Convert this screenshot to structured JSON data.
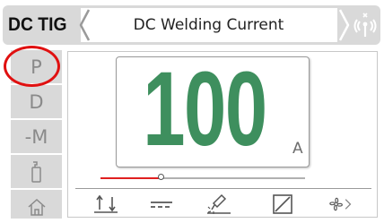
{
  "header": {
    "mode": "DC TIG",
    "title": "DC Welding Current",
    "icons": [
      "back-chevron-icon",
      "forward-chevron-icon",
      "wireless-remote-icon"
    ]
  },
  "sidebar": {
    "items": [
      {
        "label": "P",
        "icon": "p-text"
      },
      {
        "label": "D",
        "icon": "d-text"
      },
      {
        "label": "-M",
        "icon": "m-text"
      },
      {
        "label": "",
        "icon": "torch-icon"
      },
      {
        "label": "",
        "icon": "home-icon"
      }
    ],
    "highlighted": "P"
  },
  "display": {
    "value": "100",
    "unit": "A"
  },
  "slider": {
    "level": 0.3
  },
  "toolbar": {
    "icons": [
      "two-stroke-icon",
      "dc-current-icon",
      "welding-torch-icon",
      "slope-icon",
      "cooling-fan-icon"
    ]
  },
  "colors": {
    "value": "#3e8f5e",
    "highlight": "#e01010",
    "slider_fill": "#e02020",
    "panel_bg": "#d9d9d9"
  }
}
